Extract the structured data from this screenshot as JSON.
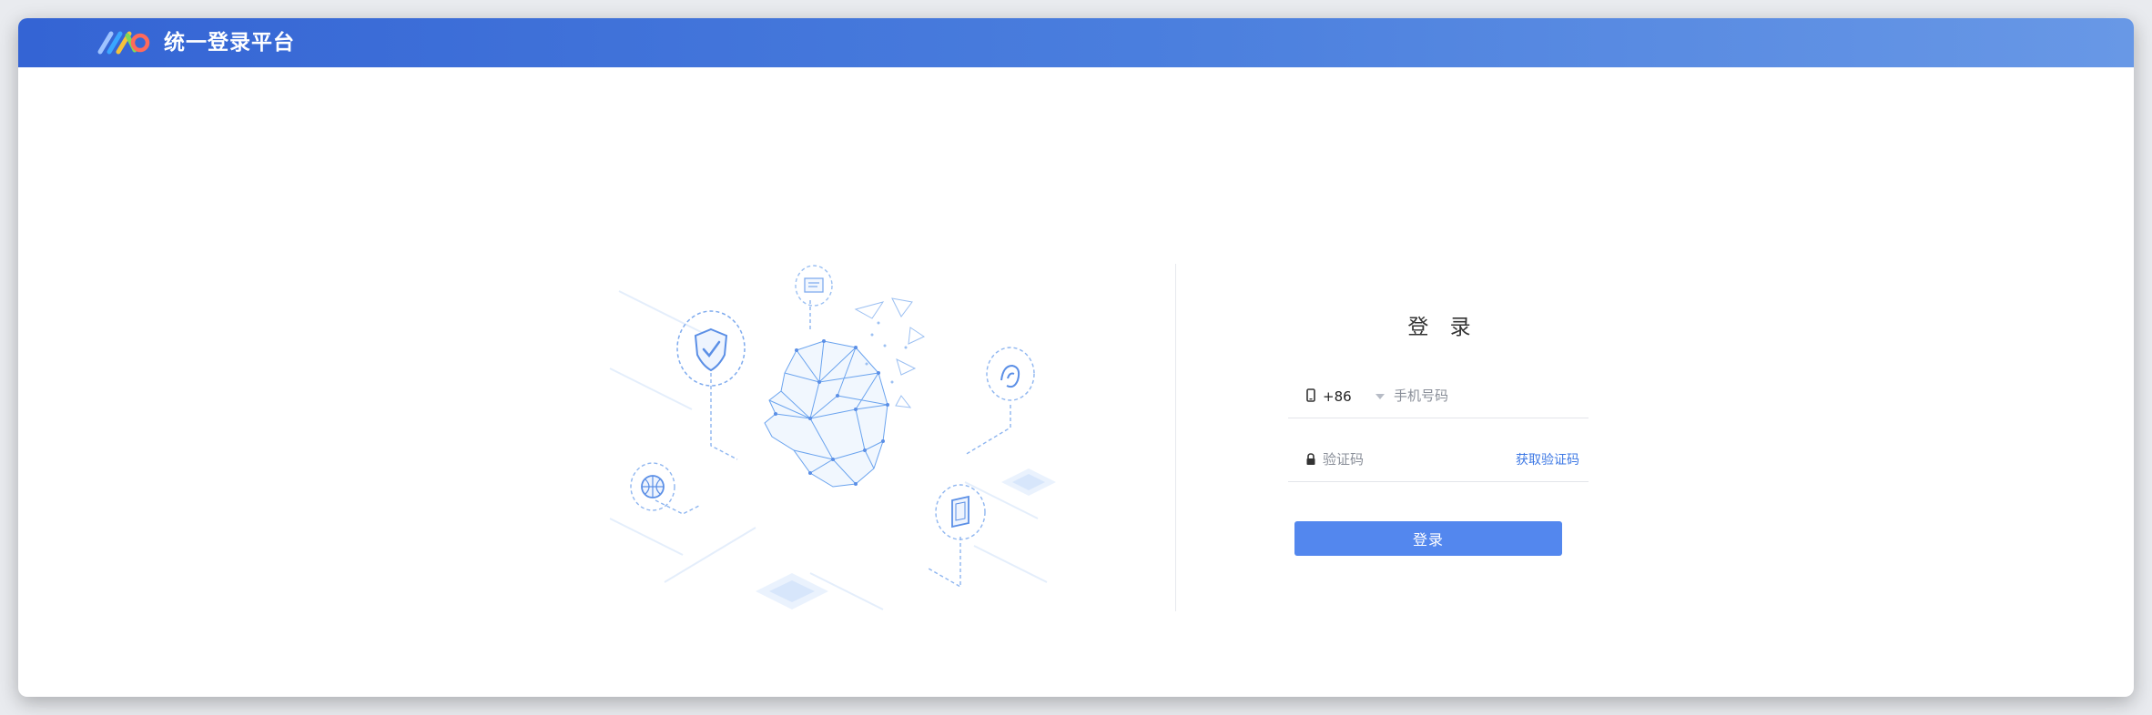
{
  "header": {
    "app_title": "统一登录平台",
    "logo_icon": "mx-logo-icon"
  },
  "login": {
    "title": "登 录",
    "country_code": "+86",
    "phone_placeholder": "手机号码",
    "code_placeholder": "验证码",
    "get_code_link": "获取验证码",
    "submit_label": "登录"
  },
  "illustration": {
    "icons": [
      "shield-check-icon",
      "document-icon",
      "fingerprint-icon",
      "globe-icon",
      "tablet-icon",
      "face-mesh-icon"
    ]
  },
  "colors": {
    "header_start": "#3464d4",
    "header_end": "#6898e6",
    "primary_button": "#5387ee",
    "link": "#3d78e4"
  }
}
